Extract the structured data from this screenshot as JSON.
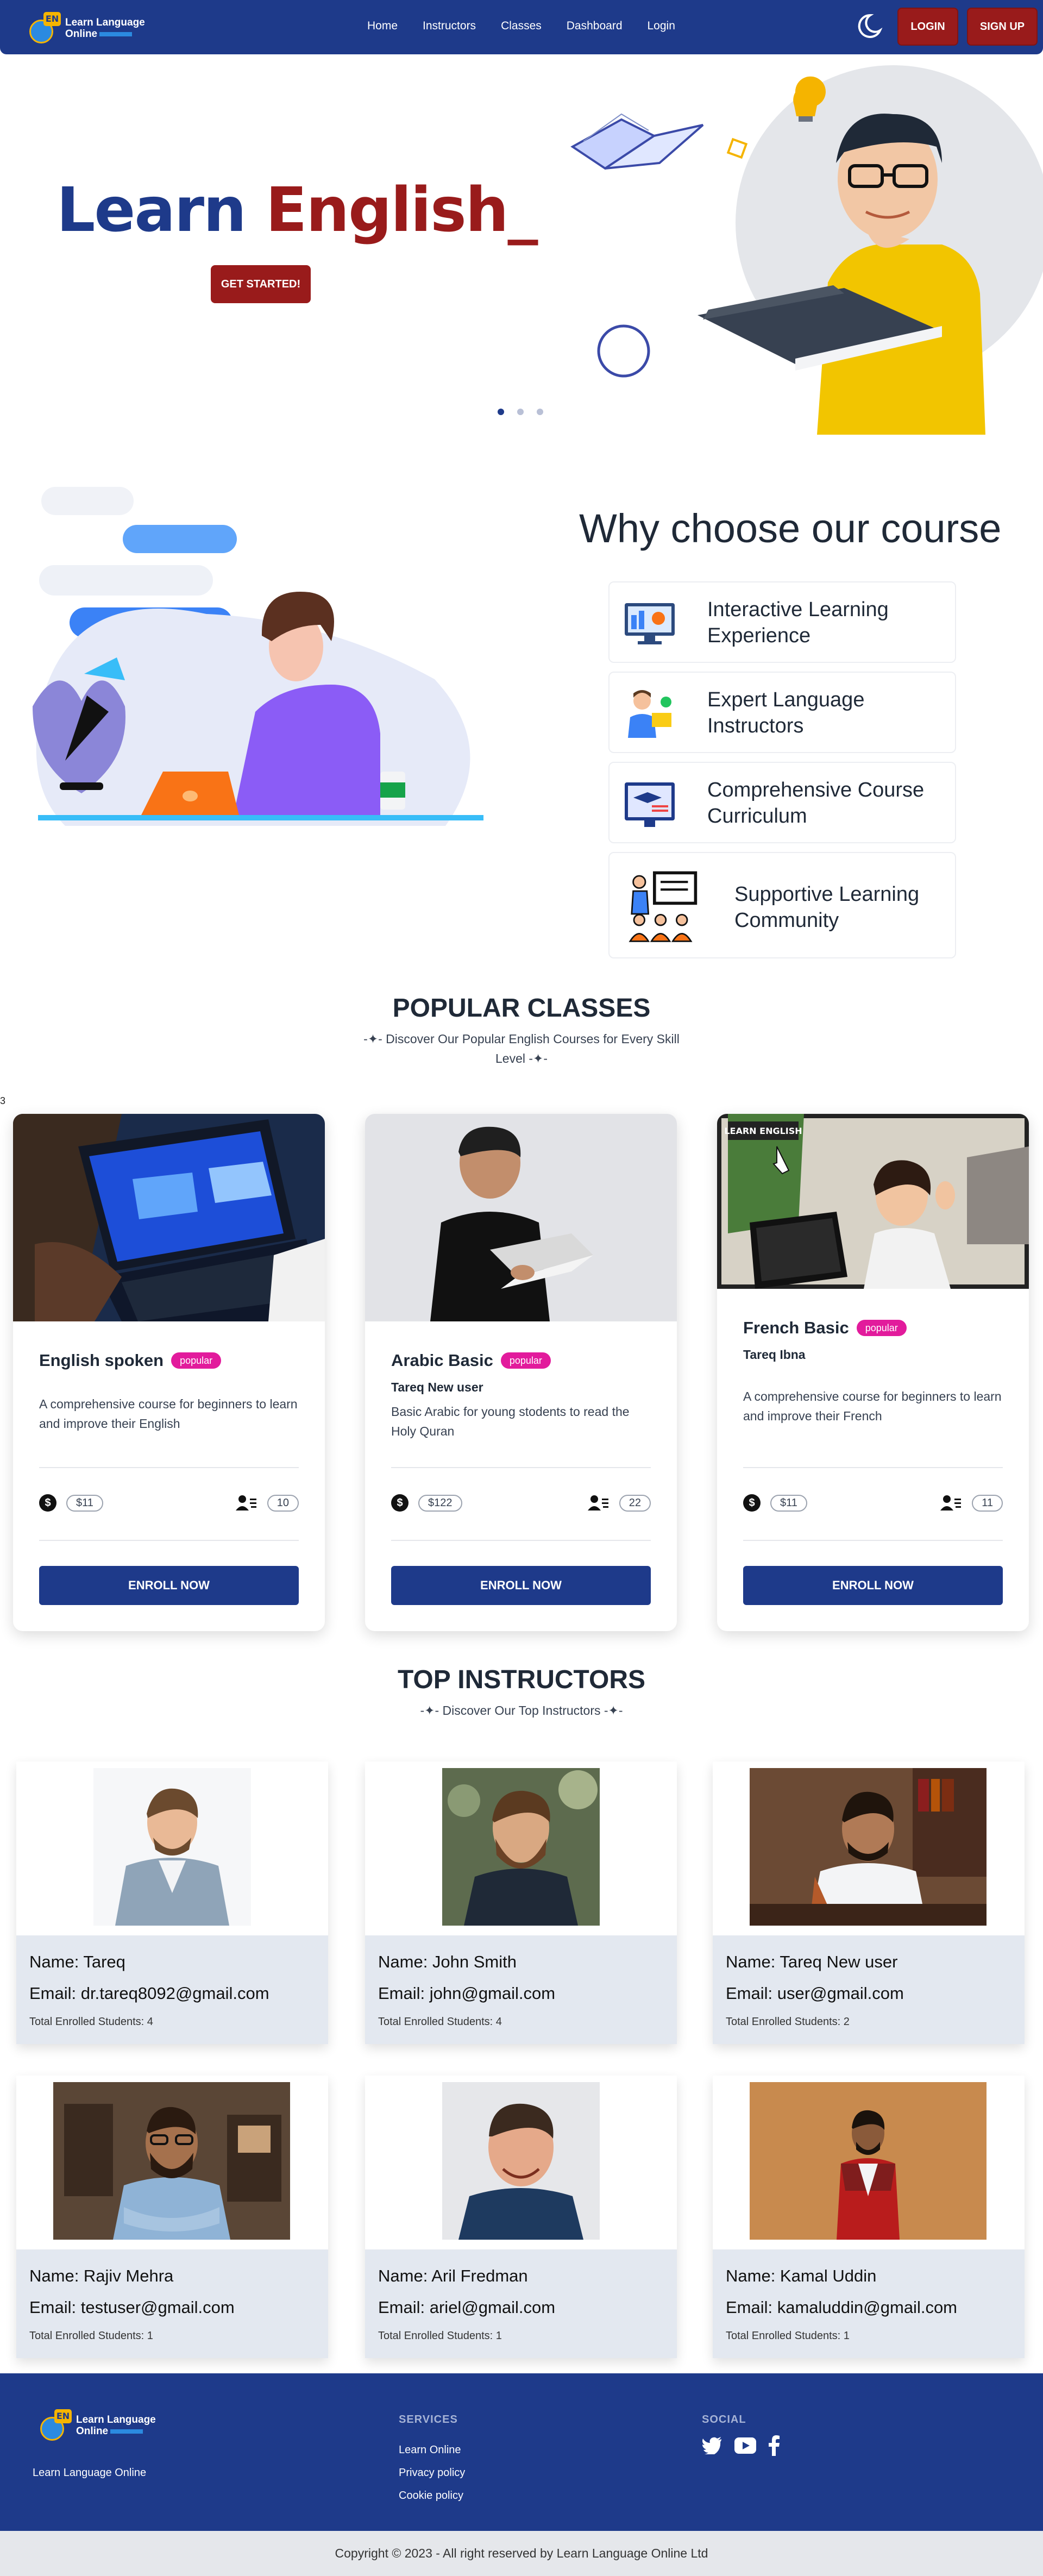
{
  "nav": {
    "logo_line1": "Learn Language",
    "logo_line2": "Online",
    "logo_mark": "EN",
    "links": [
      "Home",
      "Instructors",
      "Classes",
      "Dashboard",
      "Login"
    ],
    "login_button": "LOGIN",
    "signup_button": "SIGN UP",
    "theme_icon": "moon-icon"
  },
  "hero": {
    "title_part1": "Learn",
    "title_part2": "English_",
    "cta": "GET STARTED!",
    "carousel_pages": 3,
    "carousel_active": 1
  },
  "why": {
    "title": "Why choose our course",
    "features": [
      {
        "label": "Interactive Learning Experience",
        "icon": "monitor-chart-icon"
      },
      {
        "label": "Expert Language Instructors",
        "icon": "instructor-icon"
      },
      {
        "label": "Comprehensive Course Curriculum",
        "icon": "graduation-screen-icon"
      },
      {
        "label": "Supportive Learning Community",
        "icon": "community-icon"
      }
    ]
  },
  "popular": {
    "title": "POPULAR CLASSES",
    "subtitle": "-✦- Discover Our Popular English Courses for Every Skill Level -✦-",
    "count_label": "3",
    "classes": [
      {
        "title": "English spoken",
        "badge": "popular",
        "instructor": "",
        "description": "A comprehensive course for beginners to learn and improve their English",
        "price": "$11",
        "enrolled": "10",
        "button": "ENROLL NOW"
      },
      {
        "title": "Arabic Basic",
        "badge": "popular",
        "instructor": "Tareq New user",
        "description": "Basic Arabic for young stodents to read the Holy Quran",
        "price": "$122",
        "enrolled": "22",
        "button": "ENROLL NOW"
      },
      {
        "title": "French Basic",
        "badge": "popular",
        "instructor": "Tareq Ibna",
        "description": "A comprehensive course for beginners to learn and improve their French",
        "price": "$11",
        "enrolled": "11",
        "button": "ENROLL NOW"
      }
    ],
    "image_caption": "LEARN ENGLISH"
  },
  "instructors": {
    "title": "TOP INSTRUCTORS",
    "subtitle": "-✦- Discover Our Top Instructors -✦-",
    "list": [
      {
        "name": "Name: Tareq",
        "email": "Email: dr.tareq8092@gmail.com",
        "students": "Total Enrolled Students: 4"
      },
      {
        "name": "Name: John Smith",
        "email": "Email: john@gmail.com",
        "students": "Total Enrolled Students: 4"
      },
      {
        "name": "Name: Tareq New user",
        "email": "Email: user@gmail.com",
        "students": "Total Enrolled Students: 2"
      },
      {
        "name": "Name: Rajiv Mehra",
        "email": "Email: testuser@gmail.com",
        "students": "Total Enrolled Students: 1"
      },
      {
        "name": "Name: Aril Fredman",
        "email": "Email: ariel@gmail.com",
        "students": "Total Enrolled Students: 1"
      },
      {
        "name": "Name: Kamal Uddin",
        "email": "Email: kamaluddin@gmail.com",
        "students": "Total Enrolled Students: 1"
      }
    ]
  },
  "footer": {
    "tagline": "Learn Language Online",
    "services_heading": "SERVICES",
    "services": [
      "Learn Online",
      "Privacy policy",
      "Cookie policy"
    ],
    "social_heading": "SOCIAL",
    "social_icons": [
      "twitter-icon",
      "youtube-icon",
      "facebook-icon"
    ],
    "copyright": "Copyright © 2023 - All right reserved by Learn Language Online Ltd"
  },
  "colors": {
    "primary": "#1e3a8a",
    "accent": "#991b1b",
    "badge": "#e21b9c"
  }
}
